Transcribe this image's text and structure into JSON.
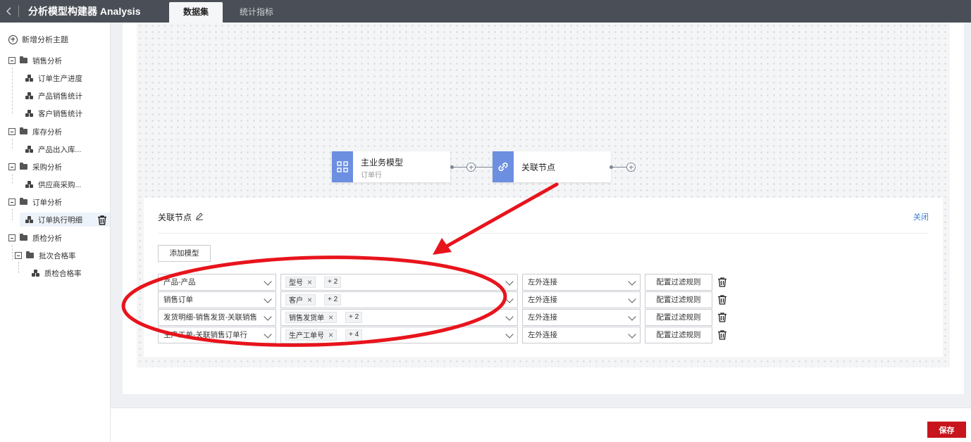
{
  "header": {
    "back_icon": "chevron-left-icon",
    "title": "分析模型构建器 Analysis",
    "tabs": [
      {
        "label": "数据集",
        "active": true
      },
      {
        "label": "统计指标",
        "active": false
      }
    ]
  },
  "sidebar": {
    "add_label": "新增分析主题",
    "groups": [
      {
        "label": "销售分析",
        "items": [
          "订单生产进度",
          "产品销售统计",
          "客户销售统计"
        ]
      },
      {
        "label": "库存分析",
        "items": [
          "产品出入库..."
        ]
      },
      {
        "label": "采购分析",
        "items": [
          "供应商采购..."
        ]
      },
      {
        "label": "订单分析",
        "items": [
          "订单执行明细"
        ]
      },
      {
        "label": "质检分析",
        "subgroups": [
          {
            "label": "批次合格率",
            "items": [
              "质检合格率"
            ]
          }
        ]
      }
    ]
  },
  "canvas": {
    "main_node": {
      "title": "主业务模型",
      "subtitle": "订单行"
    },
    "link_node": {
      "title": "关联节点"
    }
  },
  "panel": {
    "title": "关联节点",
    "close_label": "关闭",
    "add_model_label": "添加模型",
    "rows": [
      {
        "model": "产品-产品",
        "tag": "型号",
        "more": "+ 2",
        "join": "左外连接",
        "filter_label": "配置过滤规则"
      },
      {
        "model": "销售订单",
        "tag": "客户",
        "more": "+ 2",
        "join": "左外连接",
        "filter_label": "配置过滤规则"
      },
      {
        "model": "发货明细-销售发货-关联销售",
        "tag": "销售发货单",
        "more": "+ 2",
        "join": "左外连接",
        "filter_label": "配置过滤规则"
      },
      {
        "model": "生产工单-关联销售订单行",
        "tag": "生产工单号",
        "more": "+ 4",
        "join": "左外连接",
        "filter_label": "配置过滤规则"
      }
    ]
  },
  "footer": {
    "save_label": "保存"
  },
  "colors": {
    "accent": "#3a7bd5",
    "save": "#c8141c",
    "annotation": "#e8141c",
    "topbar": "#4a4f57"
  }
}
